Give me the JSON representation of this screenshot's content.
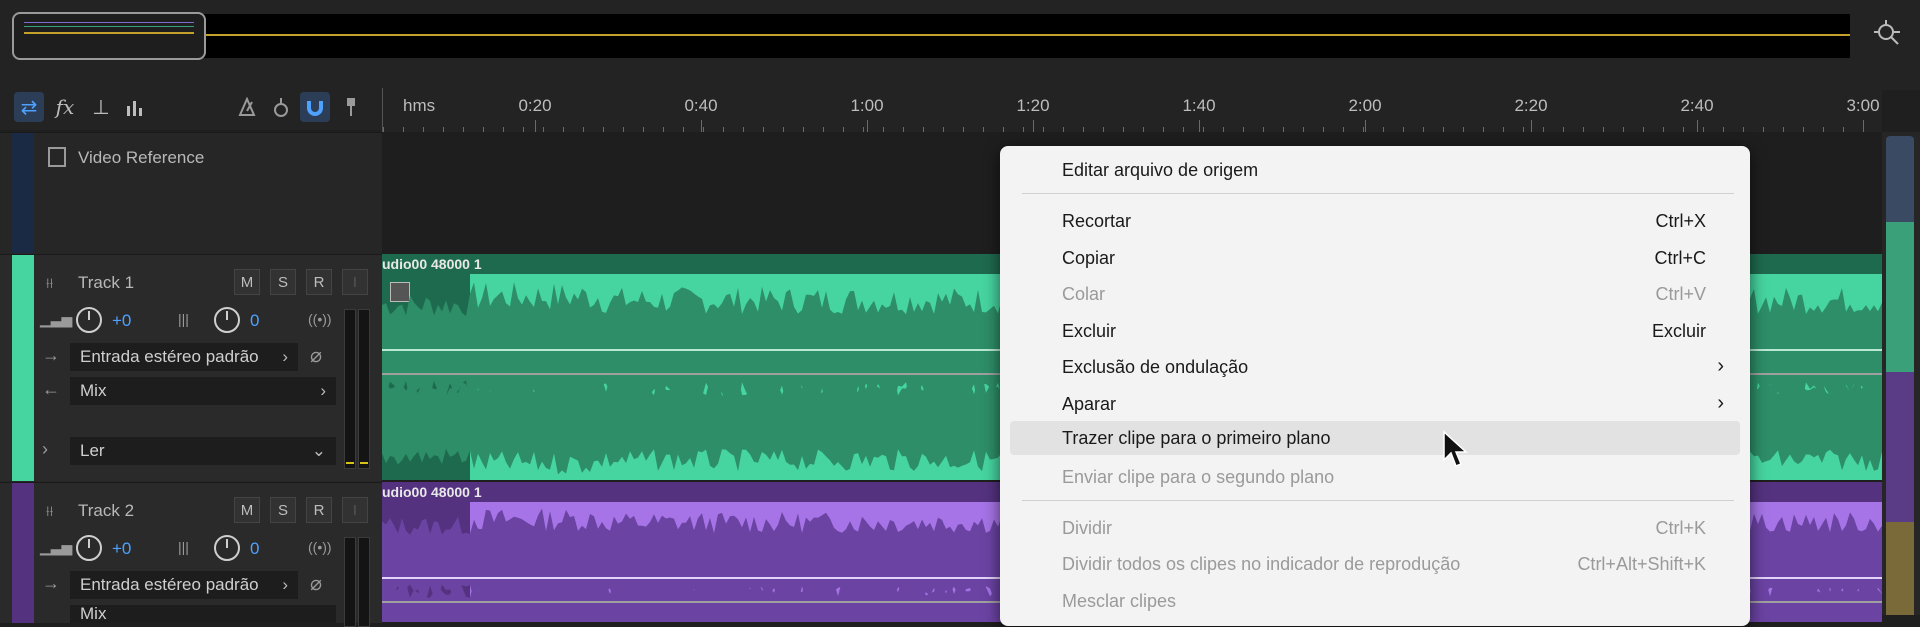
{
  "colors": {
    "track1": "#46d4a0",
    "track1_dark": "#1e6a4f",
    "track2": "#a674e6",
    "track2_dark": "#54327f",
    "accent": "#4ea1ff",
    "menu_bg": "#f3f3f3"
  },
  "overview": {
    "zoom_icon": "zoom-navigator-icon"
  },
  "toolbar": {
    "icons": [
      "swap-arrows-icon",
      "fx-icon",
      "send-icon",
      "meter-bars-icon",
      "metronome-icon",
      "scrub-icon",
      "magnet-icon",
      "marker-icon"
    ]
  },
  "ruler": {
    "unit": "hms",
    "labels": [
      "0:20",
      "0:40",
      "1:00",
      "1:20",
      "1:40",
      "2:00",
      "2:20",
      "2:40",
      "3:00"
    ]
  },
  "video_track": {
    "name": "Video Reference"
  },
  "tracks": [
    {
      "name": "Track 1",
      "buttons": [
        "M",
        "S",
        "R",
        "I"
      ],
      "volume": "+0",
      "pan": "0",
      "input": "Entrada estéreo padrão",
      "output": "Mix",
      "automation": "Ler",
      "clip_label": "udio00 48000 1"
    },
    {
      "name": "Track 2",
      "buttons": [
        "M",
        "S",
        "R",
        "I"
      ],
      "volume": "+0",
      "pan": "0",
      "input": "Entrada estéreo padrão",
      "output": "Mix",
      "clip_label": "udio00 48000 1"
    }
  ],
  "context_menu": {
    "items": [
      {
        "label": "Editar arquivo de origem",
        "shortcut": "",
        "disabled": false
      },
      {
        "label": "Recortar",
        "shortcut": "Ctrl+X",
        "disabled": false
      },
      {
        "label": "Copiar",
        "shortcut": "Ctrl+C",
        "disabled": false
      },
      {
        "label": "Colar",
        "shortcut": "Ctrl+V",
        "disabled": true
      },
      {
        "label": "Excluir",
        "shortcut": "Excluir",
        "disabled": false
      },
      {
        "label": "Exclusão de ondulação",
        "shortcut": "",
        "submenu": true,
        "disabled": false
      },
      {
        "label": "Aparar",
        "shortcut": "",
        "submenu": true,
        "disabled": false
      },
      {
        "label": "Trazer clipe para o primeiro plano",
        "shortcut": "",
        "disabled": false,
        "hovered": true
      },
      {
        "label": "Enviar clipe para o segundo plano",
        "shortcut": "",
        "disabled": true
      },
      {
        "label": "Dividir",
        "shortcut": "Ctrl+K",
        "disabled": true
      },
      {
        "label": "Dividir todos os clipes no indicador de reprodução",
        "shortcut": "Ctrl+Alt+Shift+K",
        "disabled": true
      },
      {
        "label": "Mesclar clipes",
        "shortcut": "",
        "disabled": true
      }
    ]
  }
}
